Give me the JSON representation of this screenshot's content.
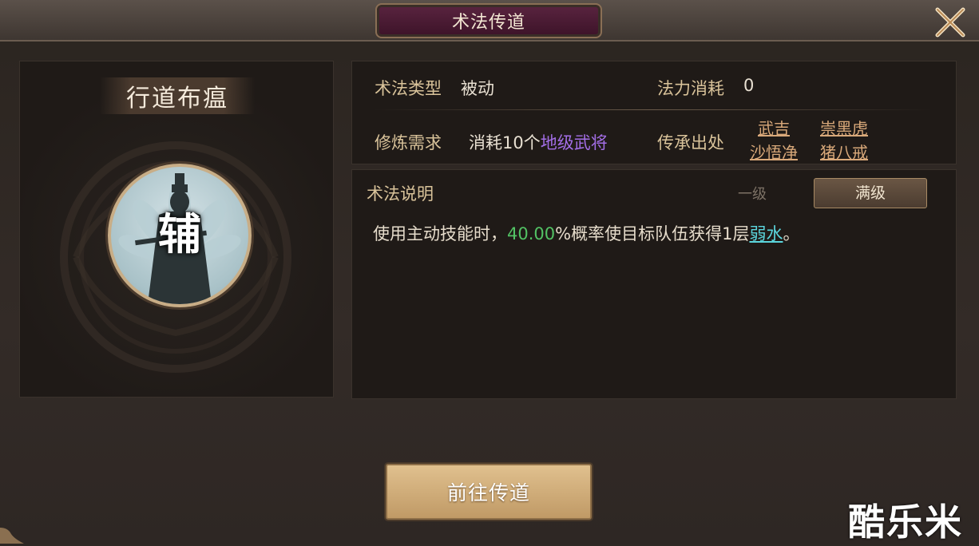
{
  "window": {
    "title": "术法传道"
  },
  "skill": {
    "name": "行道布瘟",
    "avatar_char": "辅"
  },
  "info": {
    "type_label": "术法类型",
    "type_value": "被动",
    "cost_label": "法力消耗",
    "cost_value": "0",
    "req_label": "修炼需求",
    "req_prefix": "消耗10个",
    "req_highlight": "地级武将",
    "origin_label": "传承出处",
    "origins": [
      "武吉",
      "崇黑虎",
      "沙悟净",
      "猪八戒"
    ]
  },
  "description": {
    "title": "术法说明",
    "tab_level1": "一级",
    "tab_max": "满级",
    "text_prefix": "使用主动技能时，",
    "percent": "40.00",
    "text_middle": "%概率使目标队伍获得1层",
    "keyword": "弱水",
    "text_suffix": "。"
  },
  "button": {
    "go_label": "前往传道"
  },
  "watermark": "酷乐米",
  "colors": {
    "accent_purple": "#a36ee6",
    "accent_green": "#52c264",
    "accent_cyan": "#5bd6dd",
    "button_gold": "#d7b47f"
  },
  "icons": {
    "close": "close-x-icon"
  }
}
